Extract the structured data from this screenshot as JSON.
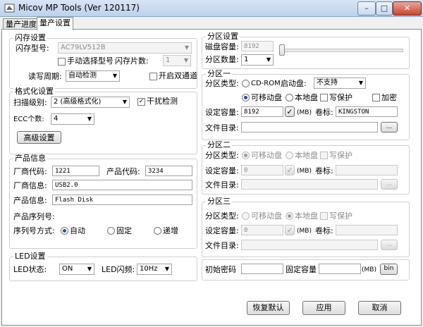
{
  "window": {
    "title": "Micov MP Tools (Ver 120117)",
    "minimize": "–",
    "maximize": "□",
    "close": "✕"
  },
  "tabs": [
    {
      "label": "量产进度"
    },
    {
      "label": "量产设置"
    }
  ],
  "flash": {
    "group_title": "闪存设置",
    "model_label": "闪存型号:",
    "model_value": "AC79LV512B",
    "manual_select_label": "手动选择型号",
    "chip_count_label": "闪存片数:",
    "chip_count_value": "1",
    "rw_cycle_label": "读写周期:",
    "rw_cycle_value": "自动检测",
    "dual_channel_label": "开启双通道"
  },
  "format": {
    "group_title": "格式化设置",
    "scan_label": "扫描级别:",
    "scan_value": "2 (高级格式化)",
    "interference_label": "干扰检测",
    "interference_checked": true,
    "ecc_label": "ECC个数:",
    "ecc_value": "4",
    "advanced_button": "高级设置"
  },
  "product": {
    "group_title": "产品信息",
    "vendor_code_label": "厂商代码:",
    "vendor_code_value": "1221",
    "product_code_label": "产品代码:",
    "product_code_value": "3234",
    "vendor_info_label": "厂商信息:",
    "vendor_info_value": "USB2.0",
    "product_info_label": "产品信息:",
    "product_info_value": "Flash Disk",
    "serial_label": "产品序列号:",
    "serial_mode_label": "序列号方式:",
    "serial_modes": [
      "自动",
      "固定",
      "递增"
    ],
    "serial_selected": "自动"
  },
  "led": {
    "group_title": "LED设置",
    "state_label": "LED状态:",
    "state_value": "ON",
    "freq_label": "LED闪频:",
    "freq_value": "10Hz"
  },
  "partition": {
    "group_title": "分区设置",
    "capacity_label": "磁盘容量:",
    "capacity_value": "8192",
    "count_label": "分区数量:",
    "count_value": "1",
    "slider_max": "8192"
  },
  "partition1": {
    "group_title": "分区一",
    "type_label": "分区类型:",
    "cdrom_label": "CD-ROM",
    "boot_label": "启动盘:",
    "boot_value": "不支持",
    "removable_label": "可移动盘",
    "local_label": "本地盘",
    "write_protect_label": "写保护",
    "encrypt_label": "加密",
    "capacity_label": "设定容量:",
    "capacity_value": "8192",
    "unit_label": "(MB)",
    "volume_label": "卷标:",
    "volume_value": "KINGSTON",
    "dir_label": "文件目录:",
    "browse": "..."
  },
  "partition2": {
    "group_title": "分区二",
    "type_label": "分区类型:",
    "removable_label": "可移动盘",
    "local_label": "本地盘",
    "write_protect_label": "写保护",
    "capacity_label": "设定容量:",
    "capacity_value": "0",
    "unit_label": "(MB)",
    "volume_label": "卷标:",
    "volume_value": "",
    "dir_label": "文件目录:",
    "browse": "..."
  },
  "partition3": {
    "group_title": "分区三",
    "type_label": "分区类型:",
    "removable_label": "可移动盘",
    "local_label": "本地盘",
    "write_protect_label": "写保护",
    "capacity_label": "设定容量:",
    "capacity_value": "0",
    "unit_label": "(MB)",
    "volume_label": "卷标:",
    "volume_value": "",
    "dir_label": "文件目录:",
    "browse": "..."
  },
  "misc": {
    "password_label": "初始密码",
    "password_value": "",
    "fixed_capacity_label": "固定容量",
    "fixed_capacity_value": "",
    "unit_label": "(MB)",
    "bin_button": "bin"
  },
  "actions": {
    "reset": "恢复默认",
    "apply": "应用",
    "cancel": "取消"
  },
  "colors": {
    "titlebar": "#c7dbf1",
    "accent": "#1f4f9c"
  }
}
